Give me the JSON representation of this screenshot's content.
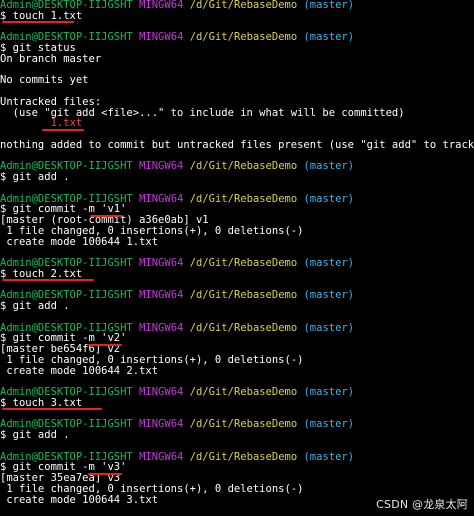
{
  "colors": {
    "background": "#000000",
    "text": "#ffffff",
    "user_host": "#1db954",
    "mingw": "#c139d9",
    "path": "#d7d15a",
    "branch": "#3fb2ea",
    "untracked_file": "#e5484d",
    "annotation_underline": "#e3261d"
  },
  "prompt": {
    "user_host": "Admin@DESKTOP-IIJGSHT",
    "env": "MINGW64",
    "path": "/d/Git/RebaseDemo",
    "branch": "(master)",
    "symbol": "$"
  },
  "lines": [
    {
      "type": "prompt"
    },
    {
      "type": "command",
      "text": "$ touch 1.txt"
    },
    {
      "type": "blank"
    },
    {
      "type": "prompt"
    },
    {
      "type": "command",
      "text": "$ git status"
    },
    {
      "type": "output",
      "text": "On branch master"
    },
    {
      "type": "blank"
    },
    {
      "type": "output",
      "text": "No commits yet"
    },
    {
      "type": "blank"
    },
    {
      "type": "output",
      "text": "Untracked files:"
    },
    {
      "type": "output",
      "text": "  (use \"git add <file>...\" to include in what will be committed)"
    },
    {
      "type": "untracked",
      "text": "        1.txt"
    },
    {
      "type": "blank"
    },
    {
      "type": "output",
      "text": "nothing added to commit but untracked files present (use \"git add\" to track)"
    },
    {
      "type": "blank"
    },
    {
      "type": "prompt"
    },
    {
      "type": "command",
      "text": "$ git add ."
    },
    {
      "type": "blank"
    },
    {
      "type": "prompt"
    },
    {
      "type": "command",
      "text": "$ git commit -m 'v1'"
    },
    {
      "type": "output",
      "text": "[master (root-commit) a36e0ab] v1"
    },
    {
      "type": "output",
      "text": " 1 file changed, 0 insertions(+), 0 deletions(-)"
    },
    {
      "type": "output",
      "text": " create mode 100644 1.txt"
    },
    {
      "type": "blank"
    },
    {
      "type": "prompt"
    },
    {
      "type": "command",
      "text": "$ touch 2.txt"
    },
    {
      "type": "blank"
    },
    {
      "type": "prompt"
    },
    {
      "type": "command",
      "text": "$ git add ."
    },
    {
      "type": "blank"
    },
    {
      "type": "prompt"
    },
    {
      "type": "command",
      "text": "$ git commit -m 'v2'"
    },
    {
      "type": "output",
      "text": "[master be654f6] v2"
    },
    {
      "type": "output",
      "text": " 1 file changed, 0 insertions(+), 0 deletions(-)"
    },
    {
      "type": "output",
      "text": " create mode 100644 2.txt"
    },
    {
      "type": "blank"
    },
    {
      "type": "prompt"
    },
    {
      "type": "command",
      "text": "$ touch 3.txt"
    },
    {
      "type": "blank"
    },
    {
      "type": "prompt"
    },
    {
      "type": "command",
      "text": "$ git add ."
    },
    {
      "type": "blank"
    },
    {
      "type": "prompt"
    },
    {
      "type": "command",
      "text": "$ git commit -m 'v3'"
    },
    {
      "type": "output",
      "text": "[master 35ea7ea] v3"
    },
    {
      "type": "output",
      "text": " 1 file changed, 0 insertions(+), 0 deletions(-)"
    },
    {
      "type": "output",
      "text": " create mode 100644 3.txt"
    }
  ],
  "watermark": "CSDN @龙泉太阿"
}
